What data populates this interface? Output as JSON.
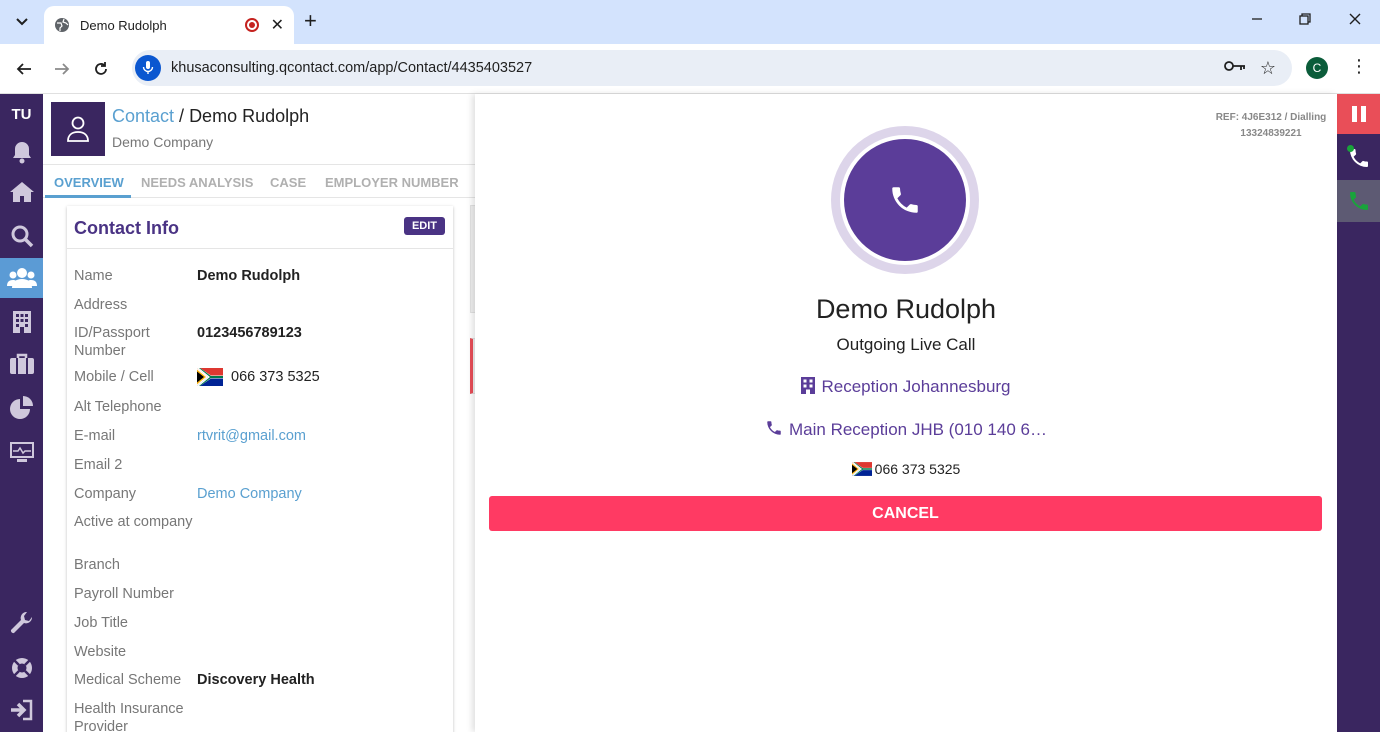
{
  "browser": {
    "tab_title": "Demo Rudolph",
    "url": "khusaconsulting.qcontact.com/app/Contact/4435403527",
    "profile_initial": "C"
  },
  "nav": {
    "user_initials": "TU",
    "items": [
      "bell-icon",
      "home-icon",
      "search-icon",
      "contacts-icon",
      "building-icon",
      "briefcase-icon",
      "reports-icon",
      "monitor-icon",
      "wrench-icon",
      "support-icon",
      "logout-icon"
    ],
    "active": "contacts-icon"
  },
  "header": {
    "breadcrumb_root": "Contact",
    "breadcrumb_sep": " / ",
    "breadcrumb_current": "Demo Rudolph",
    "company": "Demo Company"
  },
  "tabs": [
    {
      "label": "OVERVIEW",
      "active": true
    },
    {
      "label": "NEEDS ANALYSIS",
      "active": false
    },
    {
      "label": "CASE",
      "active": false
    },
    {
      "label": "EMPLOYER NUMBER",
      "active": false
    }
  ],
  "contact_info": {
    "title": "Contact Info",
    "edit_label": "EDIT",
    "fields": [
      {
        "label": "Name",
        "value": "Demo Rudolph",
        "style": "bold"
      },
      {
        "label": "Address",
        "value": "",
        "style": "plain"
      },
      {
        "label": "ID/Passport Number",
        "value": "0123456789123",
        "style": "bold"
      },
      {
        "label": "Mobile / Cell",
        "value": "066 373 5325",
        "style": "plain"
      },
      {
        "label": "Alt Telephone",
        "value": "",
        "style": "plain"
      },
      {
        "label": "E-mail",
        "value": "rtvrit@gmail.com",
        "style": "link"
      },
      {
        "label": "Email 2",
        "value": "",
        "style": "plain"
      },
      {
        "label": "Company",
        "value": "Demo Company",
        "style": "link"
      },
      {
        "label": "Active at company",
        "value": "",
        "style": "plain"
      },
      {
        "label": "Branch",
        "value": "",
        "style": "plain"
      },
      {
        "label": "Payroll Number",
        "value": "",
        "style": "plain"
      },
      {
        "label": "Job Title",
        "value": "",
        "style": "plain"
      },
      {
        "label": "Website",
        "value": "",
        "style": "plain"
      },
      {
        "label": "Medical Scheme",
        "value": "Discovery Health",
        "style": "bold"
      },
      {
        "label": "Health Insurance Provider",
        "value": "",
        "style": "plain"
      }
    ]
  },
  "call": {
    "ref_line1": "REF: 4J6E312 / Dialling",
    "ref_line2": "13324839221",
    "name": "Demo Rudolph",
    "status": "Outgoing Live Call",
    "location": "Reception Johannesburg",
    "line": "Main Reception JHB (010 140 6…",
    "number": "066 373 5325",
    "cancel_label": "CANCEL"
  },
  "colors": {
    "brand_purple": "#3a2660",
    "accent_purple": "#5b3d99",
    "link_blue": "#5aa0d0",
    "cancel_red": "#ff3a63",
    "pause_red": "#e94e58",
    "call_green": "#19a33b"
  }
}
